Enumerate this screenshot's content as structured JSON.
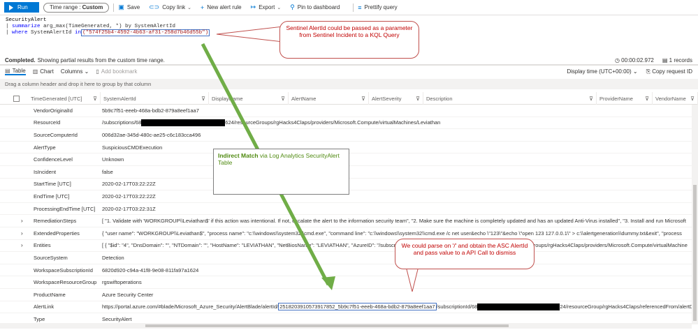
{
  "toolbar": {
    "run_label": "Run",
    "time_range_label": "Time range :",
    "time_range_value": "Custom",
    "save_label": "Save",
    "copy_link_label": "Copy link",
    "new_alert_rule_label": "New alert rule",
    "export_label": "Export",
    "pin_label": "Pin to dashboard",
    "prettify_label": "Prettify query"
  },
  "query": {
    "line1": "SecurityAlert",
    "line2_pipe": "| ",
    "line2_kw": "summarize",
    "line2_rest": " arg_max(TimeGenerated, *) by SystemAlertId",
    "line3_pipe": "| ",
    "line3_kw": "where",
    "line3_mid": " SystemAlertId ",
    "line3_in": "in",
    "line3_value": "(\"574f25b4-4592-4b63-af31-258d7b46d55b\")"
  },
  "status": {
    "completed": "Completed.",
    "message": "Showing partial results from the custom time range.",
    "elapsed": "00:00:02.972",
    "records": "1 records"
  },
  "tabs": {
    "table": "Table",
    "chart": "Chart",
    "columns": "Columns",
    "add_bookmark": "Add bookmark",
    "display_time": "Display time (UTC+00:00)",
    "copy_request": "Copy request ID"
  },
  "group_hint": "Drag a column header and drop it here to group by that column",
  "columns": [
    "TimeGenerated [UTC]",
    "SystemAlertId",
    "DisplayName",
    "AlertName",
    "AlertSeverity",
    "Description",
    "ProviderName",
    "VendorName"
  ],
  "rows": [
    {
      "key": "VendorOriginalId",
      "value": "5b9c7f51-eeeb-468a-bdb2-879a8eef1aa7",
      "expand": false
    },
    {
      "key": "ResourceId",
      "value_pre": "/subscriptions/68",
      "value_post": "624/resourceGroups/rgHacks4Claps/providers/Microsoft.Compute/virtualMachines/Leviathan",
      "expand": false,
      "redacted": true
    },
    {
      "key": "SourceComputerId",
      "value": "006d32ae-345d-480c-ae25-c6c183cca496",
      "expand": false
    },
    {
      "key": "AlertType",
      "value": "SuspiciousCMDExecution",
      "expand": false
    },
    {
      "key": "ConfidenceLevel",
      "value": "Unknown",
      "expand": false
    },
    {
      "key": "IsIncident",
      "value": "false",
      "expand": false
    },
    {
      "key": "StartTime [UTC]",
      "value": "2020-02-17T03:22:22Z",
      "expand": false
    },
    {
      "key": "EndTime [UTC]",
      "value": "2020-02-17T03:22:22Z",
      "expand": false
    },
    {
      "key": "ProcessingEndTime [UTC]",
      "value": "2020-02-17T03:22:31Z",
      "expand": false
    },
    {
      "key": "RemediationSteps",
      "value": "[ \"1. Validate with 'WORKGROUP\\\\Leviathan$' if this action was intentional. If not, escalate the alert to the information security team\", \"2. Make sure the machine is completely updated and has an updated Anti-Virus installed\", \"3. Install and run Microsoft",
      "expand": true
    },
    {
      "key": "ExtendedProperties",
      "value": "{ \"user name\": \"WORKGROUP\\\\Leviathan$\", \"process name\": \"c:\\\\windows\\\\system32\\\\cmd.exe\", \"command line\": \"c:\\\\windows\\\\system32\\\\cmd.exe /c net user&echo \\\"123\\\"&echo \\\"open 123 127.0.0.1\\\" > c:\\\\alertgeneration\\\\dummy.txt&exit\", \"process",
      "expand": true
    },
    {
      "key": "Entities",
      "value_pre": "[ { \"$id\": \"4\", \"DnsDomain\": \"\", \"NTDomain\": \"\", \"HostName\": \"LEVIATHAN\", \"NetBiosName\": \"LEVIATHAN\", \"AzureID\": \"/subscriptions/68",
      "value_post": "24/resourceGroups/rgHacks4Claps/providers/Microsoft.Compute/virtualMachine",
      "expand": true,
      "redacted": true
    },
    {
      "key": "SourceSystem",
      "value": "Detection",
      "expand": false
    },
    {
      "key": "WorkspaceSubscriptionId",
      "value": "6820d920-c94a-41f8-9e08-811fa97a1624",
      "expand": false
    },
    {
      "key": "WorkspaceResourceGroup",
      "value": "rgswiftoperations",
      "expand": false
    },
    {
      "key": "ProductName",
      "value": "Azure Security Center",
      "expand": false
    },
    {
      "key": "AlertLink",
      "value_pre": "https://portal.azure.com/#blade/Microsoft_Azure_Security/AlertBlade/alertId/",
      "value_box": "2518203910573917852_5b9c7f51-eeeb-468a-bdb2-879a8eef1aa7",
      "value_mid": "/subscriptionId/68",
      "value_post": "24/resourceGroup/rgHacks4Claps/referencedFrom/alertD",
      "expand": false,
      "redacted": true
    },
    {
      "key": "Type",
      "value": "SecurityAlert",
      "expand": false
    }
  ],
  "callouts": {
    "sentinel": "Sentinel AlertId could be passed as a parameter from Sentinel Incident to a KQL Query",
    "indirect_bold": "Indirect Match",
    "indirect_rest": " via Log Analytics SecurityAlert Table",
    "parse": "We could parse on '/' and obtain the ASC AlertId and pass value to a API Call to dismiss"
  },
  "colors": {
    "accent": "#0078d4",
    "callout_red": "#c00000",
    "callout_green_text": "#4f8a10",
    "arrow_green": "#70ad47",
    "arrow_red": "#c0504d",
    "highlight_box": "#4472c4"
  },
  "icons": [
    "play-icon",
    "save-icon",
    "link-icon",
    "plus-icon",
    "export-icon",
    "pin-icon",
    "prettify-icon",
    "clock-icon",
    "records-icon",
    "table-icon",
    "chart-icon",
    "bookmark-icon",
    "copy-icon",
    "filter-icon"
  ]
}
